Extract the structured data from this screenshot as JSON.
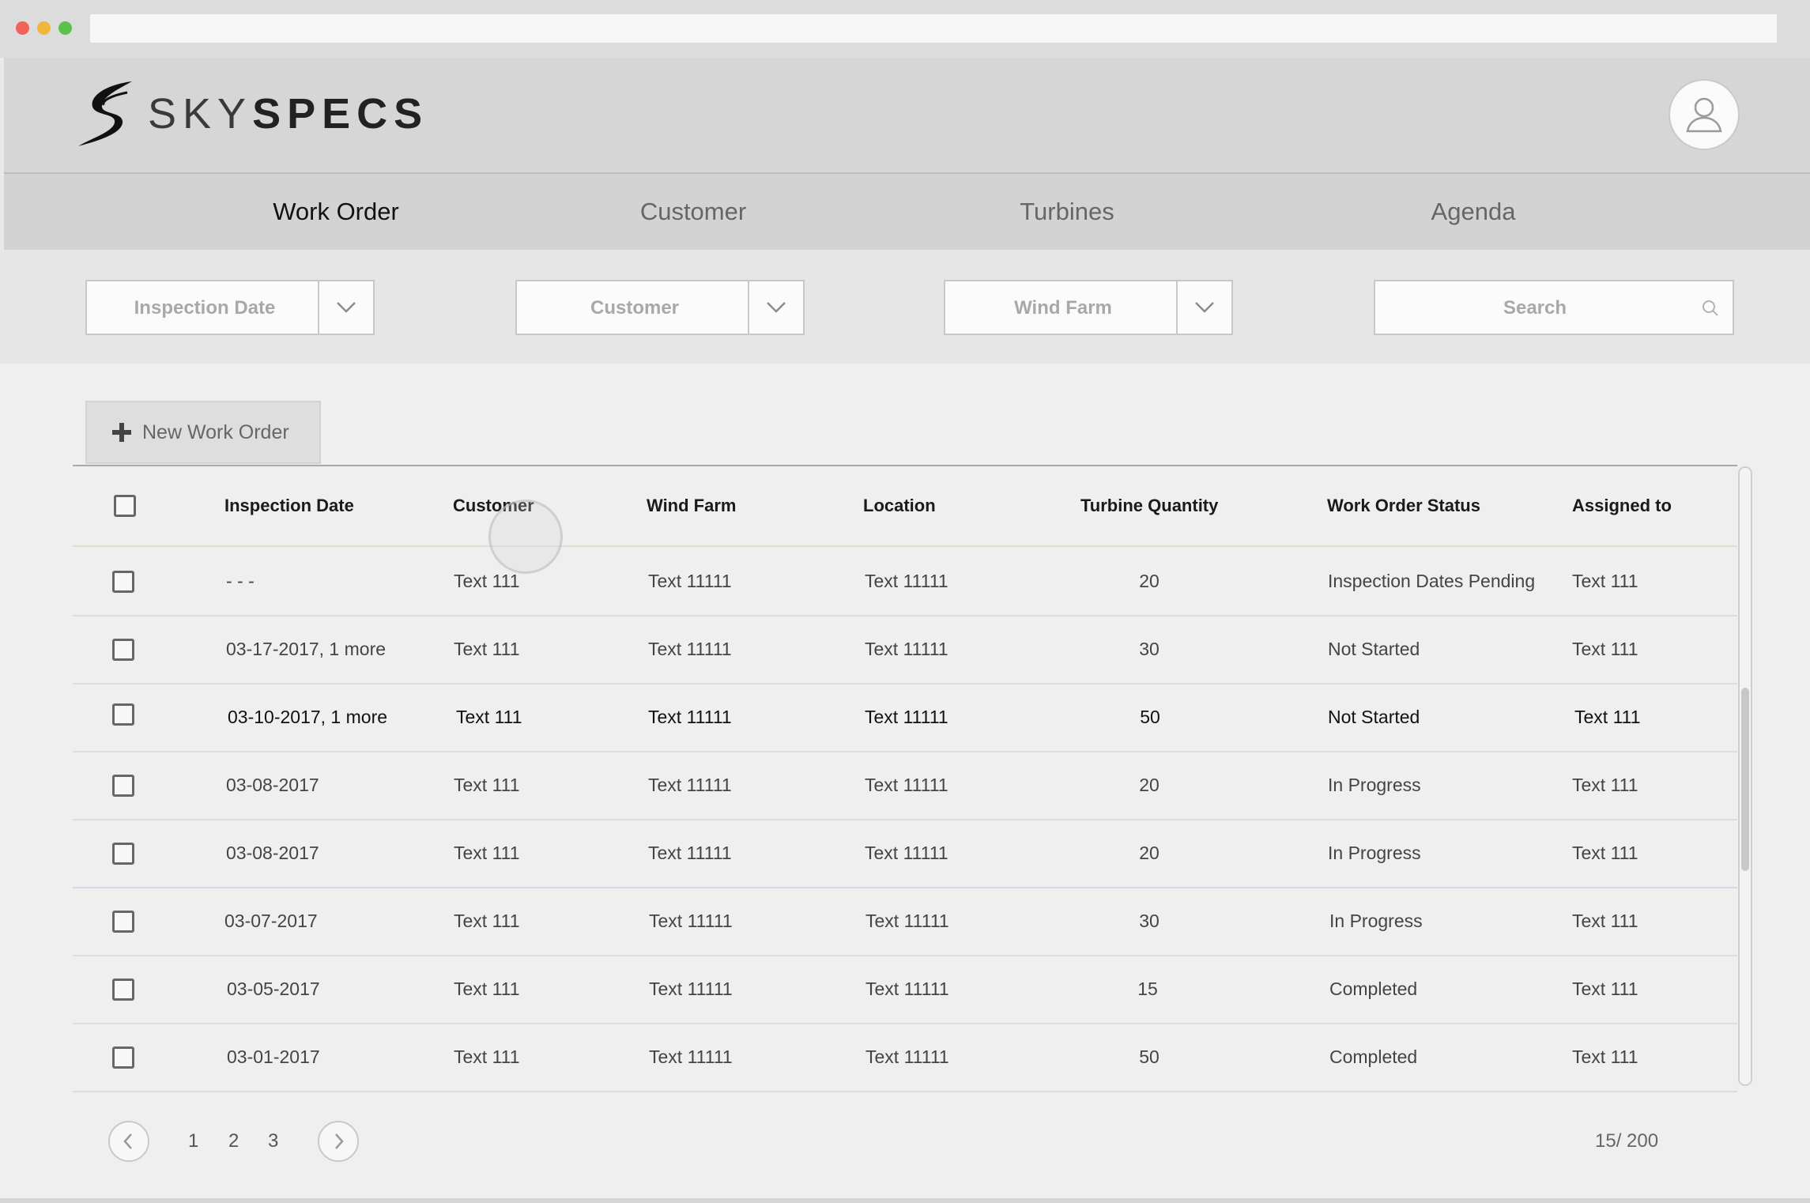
{
  "brand": {
    "sky": "SKY",
    "specs": "SPECS"
  },
  "nav": {
    "work_order": "Work Order",
    "customer": "Customer",
    "turbines": "Turbines",
    "agenda": "Agenda"
  },
  "filters": {
    "inspection_date": "Inspection Date",
    "customer": "Customer",
    "wind_farm": "Wind Farm",
    "search_placeholder": "Search"
  },
  "actions": {
    "new_work_order": "New Work Order"
  },
  "table": {
    "headers": {
      "inspection_date": "Inspection Date",
      "customer": "Customer",
      "wind_farm": "Wind Farm",
      "location": "Location",
      "turbine_quantity": "Turbine Quantity",
      "status": "Work Order Status",
      "assigned_to": "Assigned to"
    },
    "rows": [
      {
        "date": "- - -",
        "customer": "Text 111",
        "wind_farm": "Text 11111",
        "location": "Text 11111",
        "qty": "20",
        "status": "Inspection Dates Pending",
        "assigned": "Text 111"
      },
      {
        "date": "03-17-2017, 1 more",
        "customer": "Text 111",
        "wind_farm": "Text 11111",
        "location": "Text 11111",
        "qty": "30",
        "status": "Not Started",
        "assigned": "Text 111"
      },
      {
        "date": "03-10-2017, 1 more",
        "customer": "Text 111",
        "wind_farm": "Text 11111",
        "location": "Text 11111",
        "qty": "50",
        "status": "Not Started",
        "assigned": "Text 111"
      },
      {
        "date": "03-08-2017",
        "customer": "Text 111",
        "wind_farm": "Text 11111",
        "location": "Text 11111",
        "qty": "20",
        "status": "In Progress",
        "assigned": "Text 111"
      },
      {
        "date": "03-08-2017",
        "customer": "Text 111",
        "wind_farm": "Text 11111",
        "location": "Text 11111",
        "qty": "20",
        "status": "In Progress",
        "assigned": "Text 111"
      },
      {
        "date": "03-07-2017",
        "customer": "Text 111",
        "wind_farm": "Text 11111",
        "location": "Text 11111",
        "qty": "30",
        "status": "In Progress",
        "assigned": "Text 111"
      },
      {
        "date": "03-05-2017",
        "customer": "Text 111",
        "wind_farm": "Text 11111",
        "location": "Text 11111",
        "qty": "15",
        "status": "Completed",
        "assigned": "Text 111"
      },
      {
        "date": "03-01-2017",
        "customer": "Text 111",
        "wind_farm": "Text 11111",
        "location": "Text 11111",
        "qty": "50",
        "status": "Completed",
        "assigned": "Text 111"
      }
    ]
  },
  "pagination": {
    "pages": [
      "1",
      "2",
      "3"
    ],
    "count": "15/ 200"
  },
  "icons": {
    "logo": "skyspecs-swoosh-logo",
    "avatar": "user-outline-icon",
    "dropdown": "chevron-down-icon",
    "search": "search-icon",
    "add": "plus-icon",
    "prev": "chevron-left-icon",
    "next": "chevron-right-icon"
  }
}
